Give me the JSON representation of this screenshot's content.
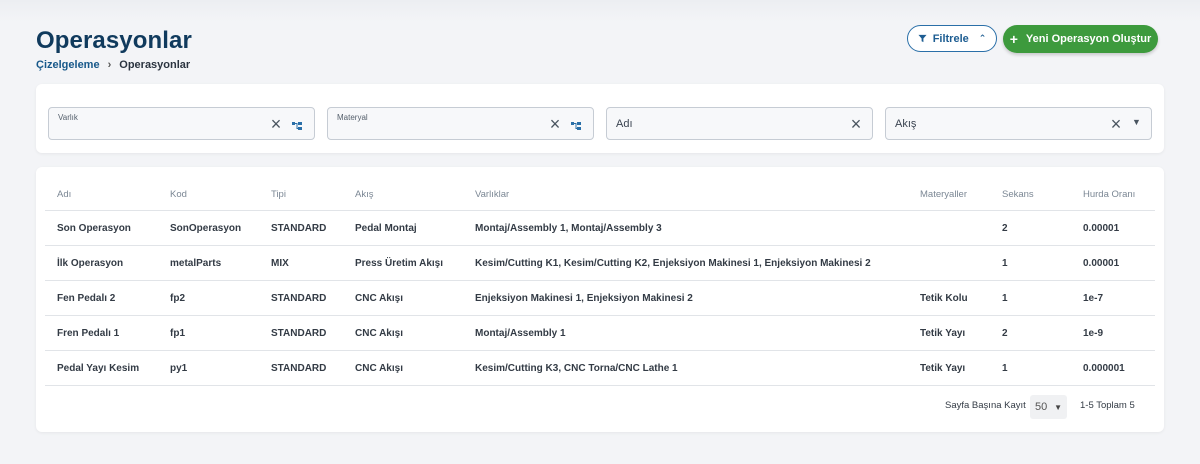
{
  "page": {
    "title": "Operasyonlar",
    "breadcrumb": [
      "Çizelgeleme",
      "Operasyonlar"
    ],
    "breadcrumb_separator": "›"
  },
  "actions": {
    "filter_label": "Filtrele",
    "create_label": "Yeni Operasyon Oluştur",
    "create_color": "#3d9a3d"
  },
  "filters": {
    "varlik_label": "Varlık",
    "materyal_label": "Materyal",
    "adi_label": "Adı",
    "akis_label": "Akış",
    "clear_icon": "close-icon",
    "tree_icon": "hierarchy-icon"
  },
  "table": {
    "columns": [
      "Adı",
      "Kod",
      "Tipi",
      "Akış",
      "Varlıklar",
      "Materyaller",
      "Sekans",
      "Hurda Oranı"
    ],
    "rows": [
      [
        "Son Operasyon",
        "SonOperasyon",
        "STANDARD",
        "Pedal Montaj",
        "Montaj/Assembly 1, Montaj/Assembly 3",
        "",
        "2",
        "0.00001"
      ],
      [
        "İlk Operasyon",
        "metalParts",
        "MIX",
        "Press Üretim Akışı",
        "Kesim/Cutting K1, Kesim/Cutting K2, Enjeksiyon Makinesi 1, Enjeksiyon Makinesi 2",
        "",
        "1",
        "0.00001"
      ],
      [
        "Fen Pedalı 2",
        "fp2",
        "STANDARD",
        "CNC Akışı",
        "Enjeksiyon Makinesi 1, Enjeksiyon Makinesi 2",
        "Tetik Kolu",
        "1",
        "1e-7"
      ],
      [
        "Fren Pedalı 1",
        "fp1",
        "STANDARD",
        "CNC Akışı",
        "Montaj/Assembly 1",
        "Tetik Yayı",
        "2",
        "1e-9"
      ],
      [
        "Pedal Yayı Kesim",
        "py1",
        "STANDARD",
        "CNC Akışı",
        "Kesim/Cutting K3, CNC Torna/CNC Lathe 1",
        "Tetik Yayı",
        "1",
        "0.000001"
      ]
    ]
  },
  "pagination": {
    "per_page_label": "Sayfa Başına Kayıt",
    "per_page_value": "50",
    "range_text": "1-5 Toplam 5"
  }
}
